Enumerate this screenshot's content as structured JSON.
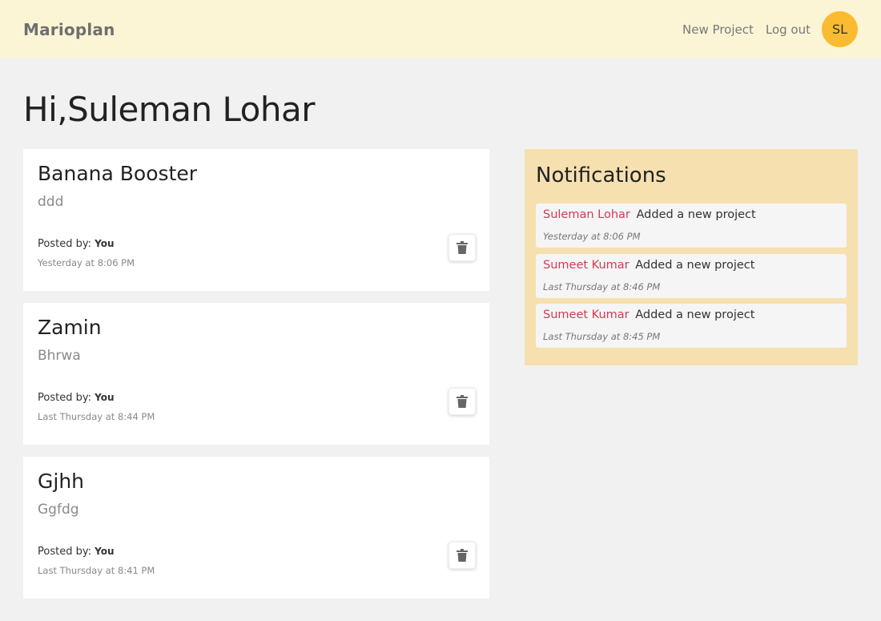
{
  "navbar": {
    "brand": "Marioplan",
    "links": {
      "new_project": "New Project",
      "log_out": "Log out"
    },
    "avatar_initials": "SL",
    "colors": {
      "background": "#fbf5d6",
      "avatar": "#fbbb30"
    }
  },
  "greeting": "Hi,Suleman Lohar",
  "projects": [
    {
      "title": "Banana Booster",
      "content": "ddd",
      "posted_by_label": "Posted by:",
      "posted_by": "You",
      "time": "Yesterday at 8:06 PM",
      "delete_icon": "trash-icon"
    },
    {
      "title": "Zamin",
      "content": "Bhrwa",
      "posted_by_label": "Posted by:",
      "posted_by": "You",
      "time": "Last Thursday at 8:44 PM",
      "delete_icon": "trash-icon"
    },
    {
      "title": "Gjhh",
      "content": "Ggfdg",
      "posted_by_label": "Posted by:",
      "posted_by": "You",
      "time": "Last Thursday at 8:41 PM",
      "delete_icon": "trash-icon"
    }
  ],
  "notifications": {
    "title": "Notifications",
    "colors": {
      "panel": "#f6e0b0",
      "user": "#d33a55"
    },
    "items": [
      {
        "user": "Suleman Lohar",
        "action": "Added a new project",
        "time": "Yesterday at 8:06 PM"
      },
      {
        "user": "Sumeet Kumar",
        "action": "Added a new project",
        "time": "Last Thursday at 8:46 PM"
      },
      {
        "user": "Sumeet Kumar",
        "action": "Added a new project",
        "time": "Last Thursday at 8:45 PM"
      }
    ]
  }
}
